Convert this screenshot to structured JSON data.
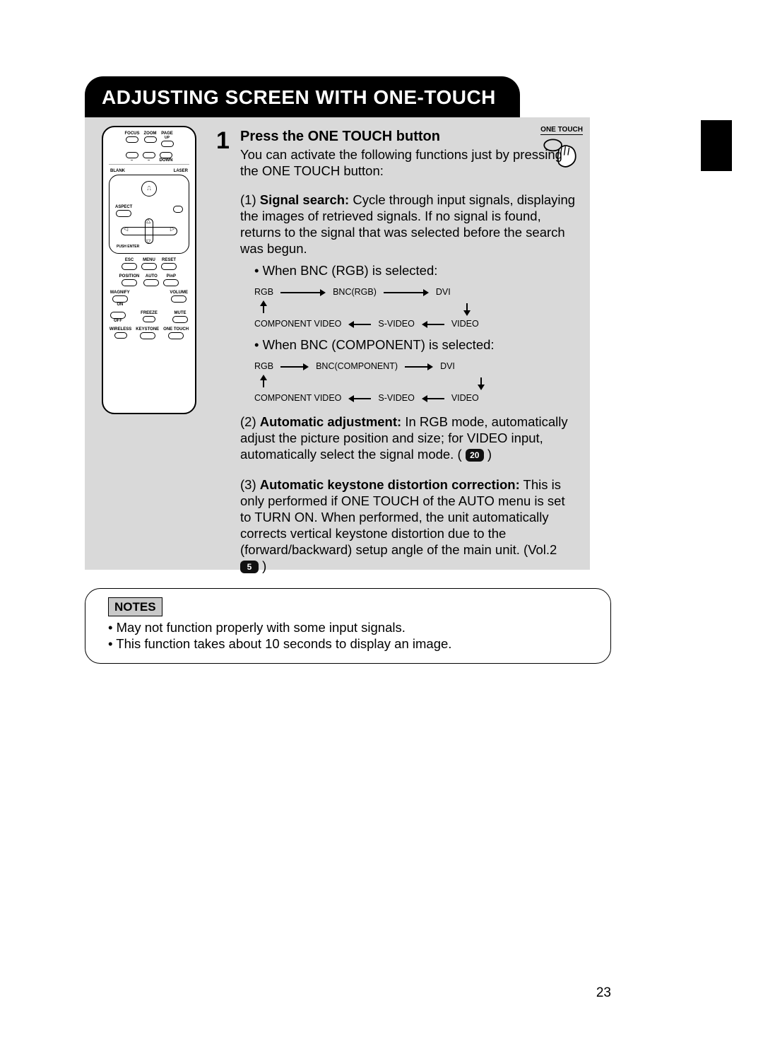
{
  "page_number": "23",
  "title": "ADJUSTING SCREEN WITH ONE-TOUCH",
  "step": {
    "number": "1",
    "title": "Press the ONE TOUCH button",
    "intro": "You can activate the following functions just by pressing the ONE TOUCH button:",
    "signal_search": {
      "prefix": "(1) ",
      "lead": "Signal search:",
      "body": " Cycle through input signals, displaying the images of retrieved signals. If no signal is found, returns to the signal that was selected before the search was begun.",
      "case_rgb_label": "• When BNC (RGB) is selected:",
      "case_comp_label": "• When BNC (COMPONENT) is selected:",
      "flow_rgb_top": [
        "RGB",
        "BNC(RGB)",
        "DVI"
      ],
      "flow_comp_top": [
        "RGB",
        "BNC(COMPONENT)",
        "DVI"
      ],
      "flow_bottom": [
        "COMPONENT VIDEO",
        "S-VIDEO",
        "VIDEO"
      ]
    },
    "auto_adjust": {
      "prefix": "(2) ",
      "lead": "Automatic adjustment:",
      "body_a": " In RGB mode, automatically adjust the picture position and size; for VIDEO input, automatically select the signal mode. ( ",
      "ref": "20",
      "body_b": " )"
    },
    "keystone": {
      "prefix": "(3) ",
      "lead": "Automatic keystone distortion correction:",
      "body_a": " This is only performed if ONE TOUCH of the AUTO menu is set to TURN ON. When performed, the unit automatically corrects vertical keystone distortion due to the (forward/backward) setup angle of the main unit. (Vol.2 ",
      "ref": "5",
      "body_b": " )"
    }
  },
  "one_touch_icon_label": "ONE TOUCH",
  "remote": {
    "row1": [
      "FOCUS",
      "ZOOM",
      "PAGE"
    ],
    "row1b": [
      "",
      "",
      "UP"
    ],
    "row2": [
      "–",
      "–",
      "DOWN"
    ],
    "blank": "BLANK",
    "laser": "LASER",
    "aspect": "ASPECT",
    "push_enter": "PUSH ENTER",
    "row_emr": [
      "ESC",
      "MENU",
      "RESET"
    ],
    "row_pap": [
      "POSITION",
      "AUTO",
      "PinP"
    ],
    "magnify": "MAGNIFY",
    "volume": "VOLUME",
    "on": "ON",
    "off": "OFF",
    "freeze": "FREEZE",
    "mute": "MUTE",
    "mute_icon": "🔇",
    "row_wko": [
      "WIRELESS",
      "KEYSTONE",
      "ONE TOUCH"
    ]
  },
  "notes": {
    "header": "NOTES",
    "items": [
      "May not function properly with some input signals.",
      "This function takes about 10 seconds to display an image."
    ]
  }
}
